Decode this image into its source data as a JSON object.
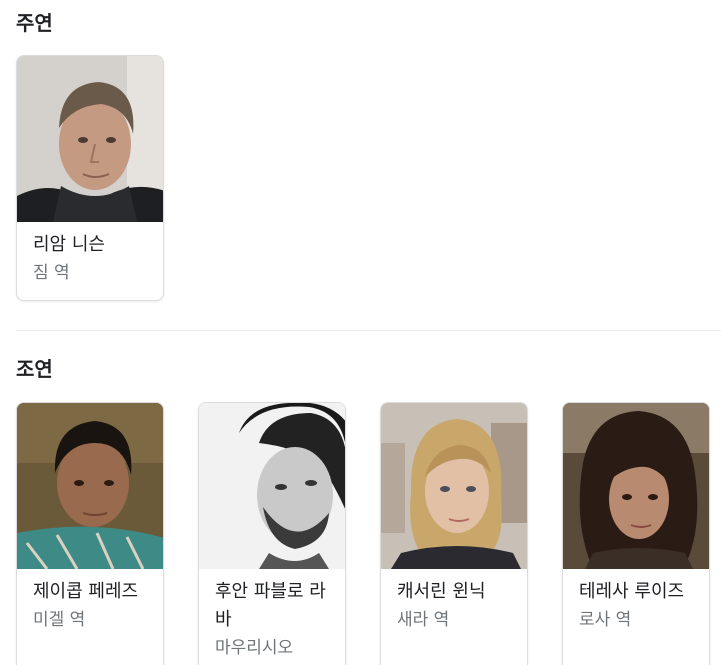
{
  "sections": {
    "main": {
      "title": "주연",
      "cast": [
        {
          "name": "리암 니슨",
          "role": "짐 역"
        }
      ]
    },
    "supporting": {
      "title": "조연",
      "cast": [
        {
          "name": "제이콥 페레즈",
          "role": "미겔 역"
        },
        {
          "name": "후안 파블로 라바",
          "role": "마우리시오"
        },
        {
          "name": "캐서린 윈닉",
          "role": "새라 역"
        },
        {
          "name": "테레사 루이즈",
          "role": "로사 역"
        }
      ]
    }
  }
}
